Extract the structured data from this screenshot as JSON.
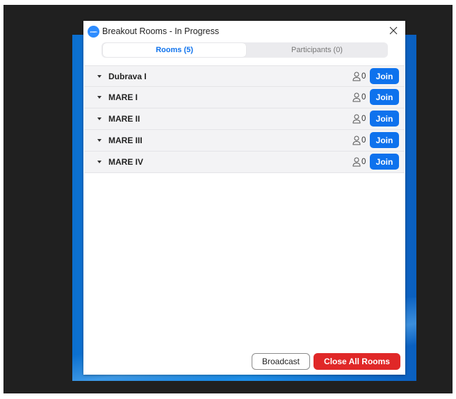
{
  "dialog": {
    "title": "Breakout Rooms - In Progress",
    "app_icon_text": "zoom"
  },
  "tabs": [
    {
      "label": "Rooms (5)",
      "active": true
    },
    {
      "label": "Participants (0)",
      "active": false
    }
  ],
  "rooms": [
    {
      "name": "Dubrava I",
      "count": "0",
      "join_label": "Join"
    },
    {
      "name": "MARE I",
      "count": "0",
      "join_label": "Join"
    },
    {
      "name": "MARE II",
      "count": "0",
      "join_label": "Join"
    },
    {
      "name": "MARE III",
      "count": "0",
      "join_label": "Join"
    },
    {
      "name": "MARE IV",
      "count": "0",
      "join_label": "Join"
    }
  ],
  "footer": {
    "broadcast_label": "Broadcast",
    "close_all_label": "Close All Rooms"
  },
  "colors": {
    "accent": "#0e72ed",
    "danger": "#e02828",
    "desktop": "#202020"
  }
}
